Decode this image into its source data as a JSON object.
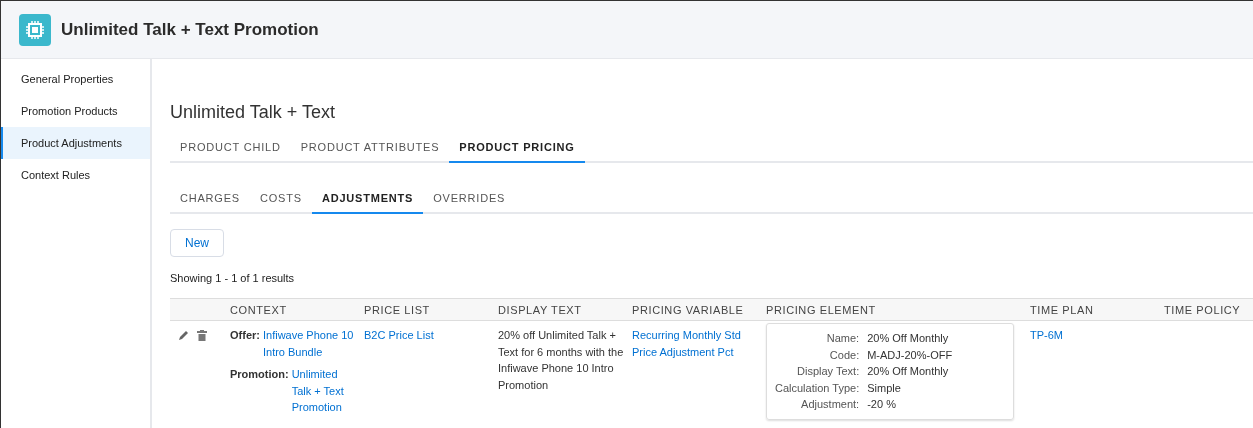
{
  "header": {
    "title": "Unlimited Talk + Text Promotion"
  },
  "sidebar": {
    "items": [
      {
        "label": "General Properties",
        "selected": false
      },
      {
        "label": "Promotion Products",
        "selected": false
      },
      {
        "label": "Product Adjustments",
        "selected": true
      },
      {
        "label": "Context Rules",
        "selected": false
      }
    ]
  },
  "page_title": "Unlimited Talk + Text",
  "tabs": [
    {
      "label": "PRODUCT CHILD",
      "selected": false
    },
    {
      "label": "PRODUCT ATTRIBUTES",
      "selected": false
    },
    {
      "label": "PRODUCT PRICING",
      "selected": true
    }
  ],
  "subtabs": [
    {
      "label": "CHARGES",
      "selected": false
    },
    {
      "label": "COSTS",
      "selected": false
    },
    {
      "label": "ADJUSTMENTS",
      "selected": true
    },
    {
      "label": "OVERRIDES",
      "selected": false
    }
  ],
  "new_button": "New",
  "results_text": "Showing 1 - 1 of 1 results",
  "table": {
    "columns": [
      "CONTEXT",
      "PRICE LIST",
      "DISPLAY TEXT",
      "PRICING VARIABLE",
      "PRICING ELEMENT",
      "TIME PLAN",
      "TIME POLICY"
    ],
    "rows": [
      {
        "context": [
          {
            "label": "Offer:",
            "value": "Infiwave Phone 10 Intro Bundle"
          },
          {
            "label": "Promotion:",
            "value": "Unlimited Talk + Text Promotion"
          }
        ],
        "price_list": "B2C Price List",
        "display_text": "20% off Unlimited Talk + Text for 6 months with the Infiwave Phone 10 Intro Promotion",
        "pricing_variable": "Recurring Monthly Std Price Adjustment Pct",
        "pricing_element": [
          {
            "label": "Name:",
            "value": "20% Off Monthly"
          },
          {
            "label": "Code:",
            "value": "M-ADJ-20%-OFF"
          },
          {
            "label": "Display Text:",
            "value": "20% Off Monthly"
          },
          {
            "label": "Calculation Type:",
            "value": "Simple"
          },
          {
            "label": "Adjustment:",
            "value": "-20 %"
          }
        ],
        "time_plan": "TP-6M"
      }
    ]
  }
}
